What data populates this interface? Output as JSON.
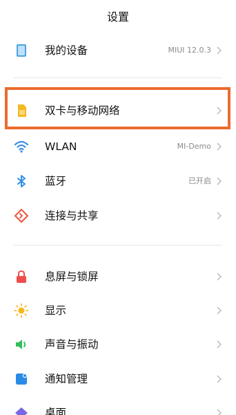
{
  "header": {
    "title": "设置"
  },
  "group1": [
    {
      "label": "我的设备",
      "value": "MIUI 12.0.3"
    }
  ],
  "group2": [
    {
      "label": "双卡与移动网络",
      "value": ""
    },
    {
      "label": "WLAN",
      "value": "MI-Demo"
    },
    {
      "label": "蓝牙",
      "value": "已开启"
    },
    {
      "label": "连接与共享",
      "value": ""
    }
  ],
  "group3": [
    {
      "label": "息屏与锁屏"
    },
    {
      "label": "显示"
    },
    {
      "label": "声音与振动"
    },
    {
      "label": "通知管理"
    },
    {
      "label": "桌面"
    }
  ],
  "colors": {
    "highlight": "#ec6b2d",
    "device_icon": "#4ba3e3",
    "sim_icon": "#f5b823",
    "wlan_icon": "#3b8fe8",
    "bluetooth_icon": "#2f8fe6",
    "connect_icon": "#ef5b46",
    "lock_icon": "#ef4d4d",
    "display_icon": "#f6b71e",
    "sound_icon": "#2fbf5b",
    "notify_icon": "#2a8be6",
    "desktop_icon": "#7b66e6"
  }
}
